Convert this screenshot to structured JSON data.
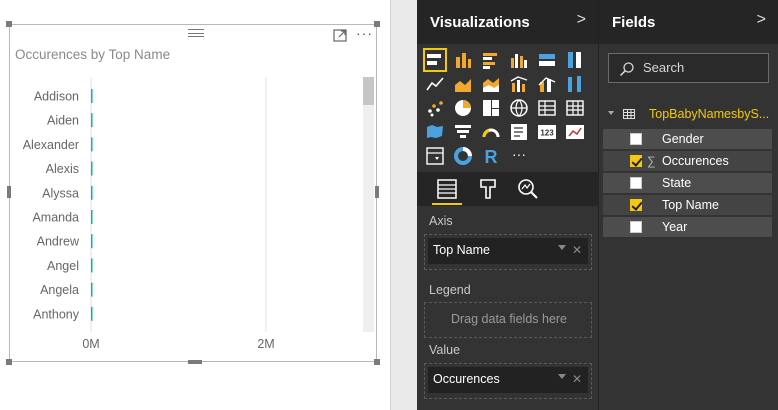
{
  "report": {
    "visual_title": "Occurences by Top Name",
    "more_label": "···"
  },
  "chart_data": {
    "type": "bar",
    "orientation": "horizontal",
    "title": "Occurences by Top Name",
    "categories": [
      "Addison",
      "Aiden",
      "Alexander",
      "Alexis",
      "Alyssa",
      "Amanda",
      "Andrew",
      "Angel",
      "Angela",
      "Anthony"
    ],
    "values": [
      2000,
      1900,
      1800,
      1900,
      1700,
      3000,
      1800,
      2000,
      1600,
      1800
    ],
    "x_ticks": [
      {
        "value": 0,
        "label": "0M"
      },
      {
        "value": 2000000,
        "label": "2M"
      }
    ],
    "xlim": [
      0,
      2000000
    ],
    "grid": true,
    "bar_color": "#01b8aa",
    "grid_color": "#e2e2e2",
    "label_color": "#666666"
  },
  "visualizations": {
    "title": "Visualizations",
    "chevron": ">",
    "icons": [
      "stacked-bar-chart-icon",
      "stacked-column-chart-icon",
      "clustered-bar-chart-icon",
      "clustered-column-chart-icon",
      "100-stacked-bar-chart-icon",
      "100-stacked-column-chart-icon",
      "line-chart-icon",
      "area-chart-icon",
      "stacked-area-chart-icon",
      "line-clustered-column-icon",
      "line-stacked-column-icon",
      "ribbon-chart-icon",
      "scatter-chart-icon",
      "pie-chart-icon",
      "treemap-icon",
      "map-icon",
      "table-icon",
      "matrix-icon",
      "filled-map-icon",
      "funnel-icon",
      "gauge-icon",
      "multi-row-card-icon",
      "card-icon",
      "kpi-icon",
      "slicer-icon",
      "donut-chart-icon",
      "r-script-icon",
      "more-visuals-icon"
    ],
    "selected_icon": 0,
    "card_text": "123",
    "r_text": "R",
    "more_text": "···",
    "tabs": [
      "fields-tab-icon",
      "format-tab-icon",
      "analytics-tab-icon"
    ],
    "wells": {
      "axis_label": "Axis",
      "axis_field": "Top Name",
      "legend_label": "Legend",
      "legend_placeholder": "Drag data fields here",
      "value_label": "Value",
      "value_field": "Occurences",
      "remove_glyph": "✕"
    }
  },
  "fields": {
    "title": "Fields",
    "chevron": ">",
    "search_placeholder": "Search",
    "table_name": "TopBabyNamesbyS...",
    "items": [
      {
        "name": "Gender",
        "checked": false,
        "sigma": false
      },
      {
        "name": "Occurences",
        "checked": true,
        "sigma": true
      },
      {
        "name": "State",
        "checked": false,
        "sigma": false
      },
      {
        "name": "Top Name",
        "checked": true,
        "sigma": false
      },
      {
        "name": "Year",
        "checked": false,
        "sigma": false
      }
    ],
    "sigma_glyph": "∑"
  },
  "colors": {
    "accent": "#f2c811",
    "pane_bg": "#333333",
    "pane_header_bg": "#252525",
    "bar": "#01b8aa"
  }
}
